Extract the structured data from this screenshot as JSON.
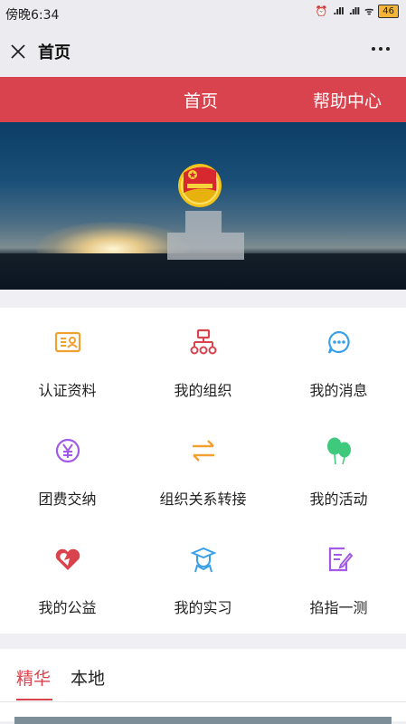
{
  "status_bar": {
    "time": "傍晚6:34",
    "battery": "46"
  },
  "title_bar": {
    "title": "首页"
  },
  "top_nav": {
    "home": "首页",
    "help": "帮助中心"
  },
  "grid": [
    {
      "label": "认证资料",
      "icon": "id-card-icon",
      "color": "#f1a132"
    },
    {
      "label": "我的组织",
      "icon": "org-chart-icon",
      "color": "#d9434e"
    },
    {
      "label": "我的消息",
      "icon": "message-icon",
      "color": "#3aa0e8"
    },
    {
      "label": "团费交纳",
      "icon": "yuan-icon",
      "color": "#a25ae6"
    },
    {
      "label": "组织关系转接",
      "icon": "transfer-icon",
      "color": "#f1a132"
    },
    {
      "label": "我的活动",
      "icon": "balloons-icon",
      "color": "#3ec97c"
    },
    {
      "label": "我的公益",
      "icon": "heart-icon",
      "color": "#d9434e"
    },
    {
      "label": "我的实习",
      "icon": "graduate-icon",
      "color": "#3aa0e8"
    },
    {
      "label": "掐指一测",
      "icon": "quiz-icon",
      "color": "#a25ae6"
    }
  ],
  "tabs": [
    {
      "label": "精华"
    },
    {
      "label": "本地"
    }
  ]
}
